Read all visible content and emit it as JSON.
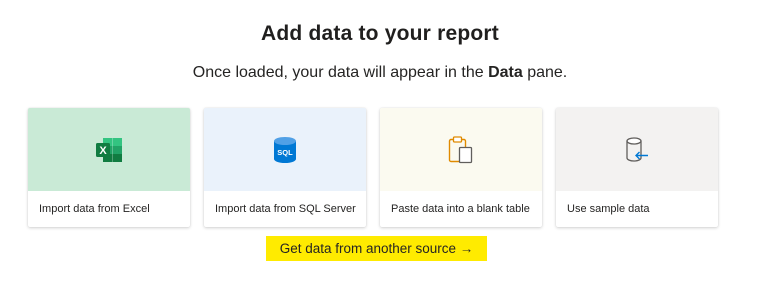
{
  "header": {
    "title": "Add data to your report",
    "subtitle_prefix": "Once loaded, your data will appear in the ",
    "subtitle_bold": "Data",
    "subtitle_suffix": " pane."
  },
  "cards": [
    {
      "label": "Import data from Excel",
      "icon": "excel-icon",
      "bg": "#c9ead6"
    },
    {
      "label": "Import data from SQL Server",
      "icon": "sql-database-icon",
      "bg": "#eaf2fb"
    },
    {
      "label": "Paste data into a blank table",
      "icon": "paste-table-icon",
      "bg": "#fbfaf0"
    },
    {
      "label": "Use sample data",
      "icon": "sample-data-icon",
      "bg": "#f3f2f1"
    }
  ],
  "link": {
    "label": "Get data from another source →",
    "highlight": "#ffeb00"
  },
  "icon_text": {
    "excel": "X",
    "sql": "SQL"
  }
}
